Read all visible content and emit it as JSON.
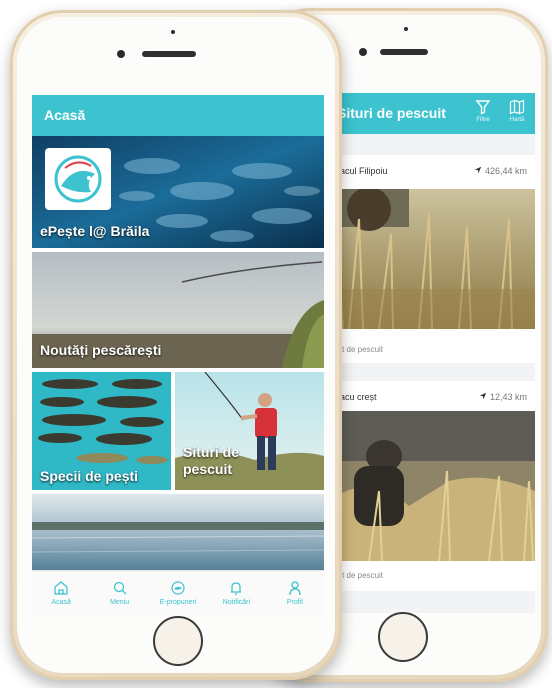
{
  "front": {
    "appbar_title": "Acasă",
    "tiles": {
      "brand": "ePește l@ Brăila",
      "news": "Noutăți pescărești",
      "species": "Specii de pești",
      "spots": "Situri de pescuit"
    },
    "nav": [
      {
        "label": "Acasă",
        "icon": "home-icon"
      },
      {
        "label": "Meniu",
        "icon": "search-icon"
      },
      {
        "label": "E-propuneri",
        "icon": "fish-icon"
      },
      {
        "label": "Notificări",
        "icon": "bell-icon"
      },
      {
        "label": "Profil",
        "icon": "profile-icon"
      }
    ]
  },
  "back": {
    "appbar_title": "Situri de pescuit",
    "actions": [
      {
        "label": "Filtre",
        "icon": "filter-icon"
      },
      {
        "label": "Hartă",
        "icon": "map-icon"
      }
    ],
    "cards": [
      {
        "title": "Lacul Filipoiu",
        "distance": "426,44 km",
        "footer": "Sit de pescuit"
      },
      {
        "title": "Lacu creșt",
        "distance": "12,43 km",
        "footer": "Sit de pescuit"
      }
    ]
  },
  "colors": {
    "accent": "#3cc3cf",
    "gold": "#e9dcc4"
  }
}
